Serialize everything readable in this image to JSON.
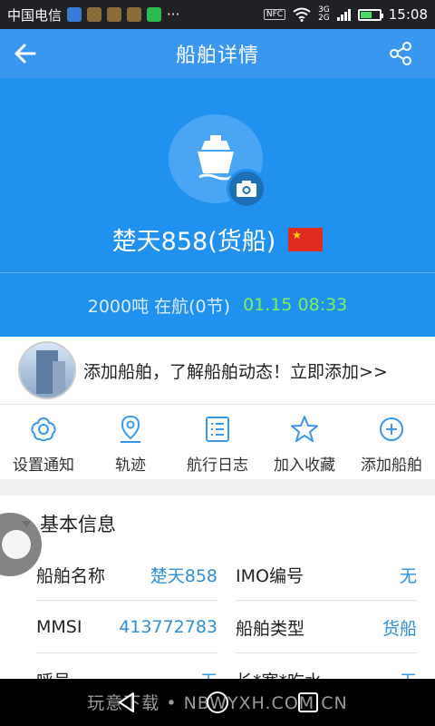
{
  "status_bar": {
    "carrier": "中国电信",
    "more": "···",
    "nfc": "NFC",
    "net_top": "3G",
    "net_bottom": "2G",
    "time": "15:08",
    "battery_level": 0.6
  },
  "app_bar": {
    "title": "船舶详情"
  },
  "ship": {
    "name": "楚天858(货船)",
    "flag": "China",
    "tonnage_status": "2000吨 在航(0节)",
    "timestamp": "01.15 08:33"
  },
  "promo": {
    "text": "添加船舶，了解船舶动态！立即添加>>"
  },
  "actions": [
    {
      "label": "设置通知",
      "icon": "flower-icon"
    },
    {
      "label": "轨迹",
      "icon": "location-pin-icon"
    },
    {
      "label": "航行日志",
      "icon": "list-icon"
    },
    {
      "label": "加入收藏",
      "icon": "star-icon"
    },
    {
      "label": "添加船舶",
      "icon": "plus-circle-icon"
    }
  ],
  "basic_info": {
    "title": "基本信息",
    "rows": [
      {
        "l1": "船舶名称",
        "v1": "楚天858",
        "l2": "IMO编号",
        "v2": "无"
      },
      {
        "l1": "MMSI",
        "v1": "413772783",
        "l2": "船舶类型",
        "v2": "货船"
      },
      {
        "l1": "呼号",
        "v1": "无",
        "l2": "长*宽*吃水",
        "v2": "无"
      }
    ]
  },
  "watermark": "玩意下载 • NBWYXH.COM.CN",
  "colors": {
    "app_bar": "#3a97f0",
    "hero": "#2191ef",
    "value_text": "#2f8fd8",
    "timestamp": "#7cf05a"
  }
}
